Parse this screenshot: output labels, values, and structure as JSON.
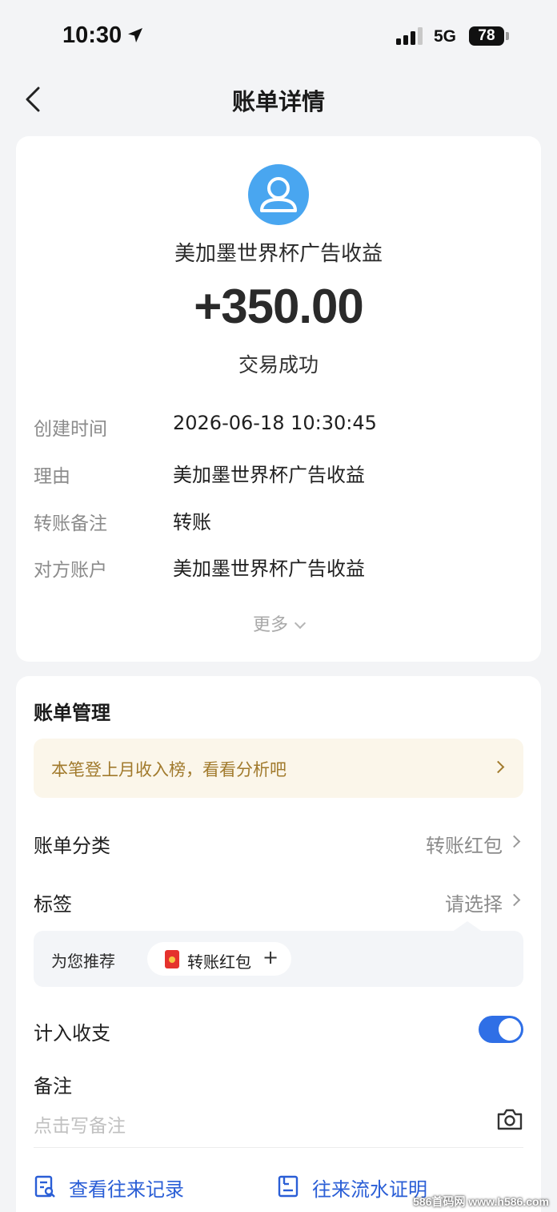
{
  "status_bar": {
    "time": "10:30",
    "network": "5G",
    "battery": "78"
  },
  "nav": {
    "title": "账单详情"
  },
  "transaction": {
    "merchant": "美加墨世界杯广告收益",
    "amount": "+350.00",
    "status": "交易成功",
    "details": [
      {
        "label": "创建时间",
        "value": "2026-06-18 10:30:45"
      },
      {
        "label": "理由",
        "value": "美加墨世界杯广告收益"
      },
      {
        "label": "转账备注",
        "value": "转账"
      },
      {
        "label": "对方账户",
        "value": "美加墨世界杯广告收益"
      }
    ],
    "more_label": "更多"
  },
  "management": {
    "title": "账单管理",
    "banner_text": "本笔登上月收入榜，看看分析吧",
    "category_label": "账单分类",
    "category_value": "转账红包",
    "tag_label": "标签",
    "tag_value": "请选择",
    "recommend_label": "为您推荐",
    "recommend_chip": "转账红包",
    "chip_plus": "+",
    "count_label": "计入收支",
    "count_enabled": true,
    "note_label": "备注",
    "note_placeholder": "点击写备注"
  },
  "actions": [
    {
      "label": "查看往来记录",
      "icon": "record-search-icon"
    },
    {
      "label": "往来流水证明",
      "icon": "statement-proof-icon"
    }
  ],
  "watermark": "586首码网 www.h586.com",
  "colors": {
    "accent": "#2f6fe6",
    "link": "#2a5ed6",
    "avatar": "#49a6f0",
    "banner_text": "#a17a2c",
    "banner_bg": "#fbf6ea"
  }
}
